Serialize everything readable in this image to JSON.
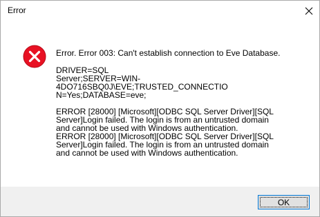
{
  "window": {
    "title": "Error",
    "close_icon": "close-icon"
  },
  "message": {
    "icon": "error-icon",
    "headline": "Error. Error 003: Can't establish connection to Eve Database.",
    "connection_lines": [
      "DRIVER=SQL",
      "Server;SERVER=WIN-4DO716SBQ0J\\EVE;TRUSTED_CONNECTIO",
      "N=Yes;DATABASE=eve;"
    ],
    "error_lines": [
      "ERROR [28000] [Microsoft][ODBC SQL Server Driver][SQL",
      "Server]Login failed. The login is from an untrusted domain",
      "and cannot be used with Windows authentication.",
      "ERROR [28000] [Microsoft][ODBC SQL Server Driver][SQL",
      "Server]Login failed. The login is from an untrusted domain",
      "and cannot be used with Windows authentication."
    ]
  },
  "buttons": {
    "ok_label": "OK"
  },
  "colors": {
    "icon_red": "#e81123",
    "button_focus": "#0078d7",
    "footer_bg": "#f0f0f0"
  }
}
